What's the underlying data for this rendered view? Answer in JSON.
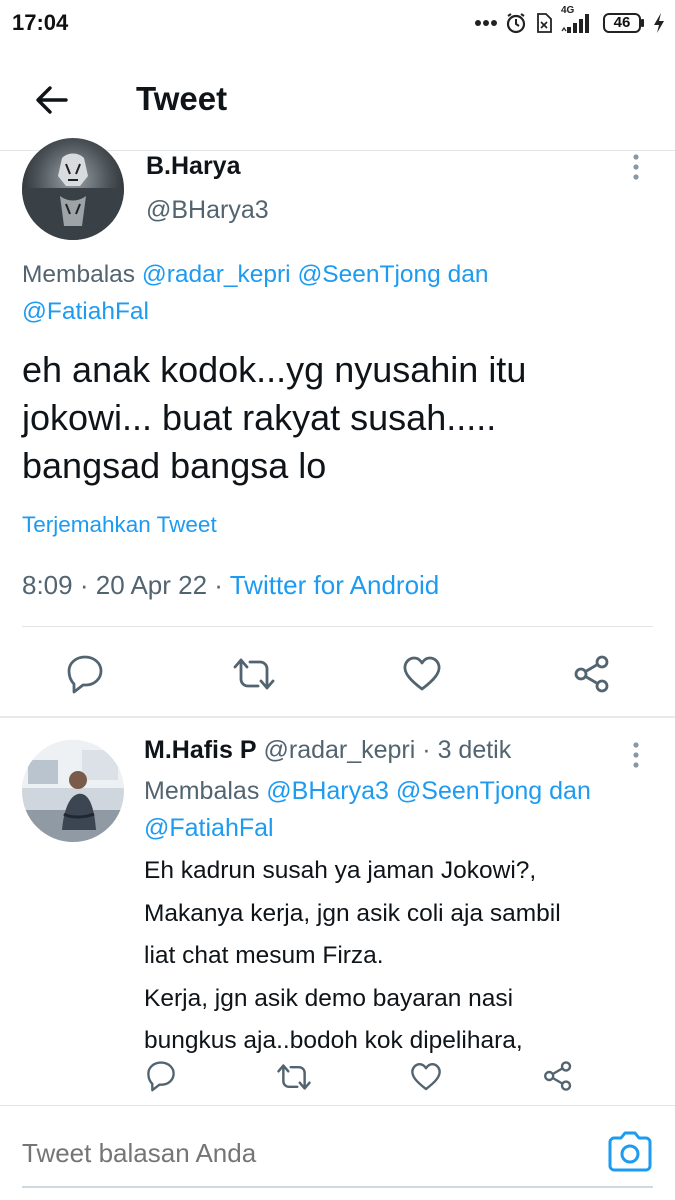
{
  "status_bar": {
    "time": "17:04",
    "network": "4G",
    "battery": "46",
    "icons": [
      "more-dots-icon",
      "alarm-icon",
      "no-sim-icon",
      "signal-icon",
      "battery-icon",
      "charging-icon"
    ]
  },
  "header": {
    "title": "Tweet",
    "back_icon": "arrow-left-icon"
  },
  "main_tweet": {
    "author_name": "B.Harya",
    "author_handle": "@BHarya3",
    "reply_prefix": "Membalas",
    "mentions": [
      "@radar_kepri",
      "@SeenTjong"
    ],
    "mention_joiner": "dan",
    "last_mention": "@FatiahFal",
    "text_lines": [
      "eh anak kodok...yg nyusahin itu",
      "jokowi... buat rakyat susah.....",
      "bangsad bangsa lo"
    ],
    "translate_label": "Terjemahkan Tweet",
    "time": "8:09",
    "date": "20 Apr 22",
    "source": "Twitter for Android",
    "actions": [
      "reply-icon",
      "retweet-icon",
      "like-icon",
      "share-icon"
    ]
  },
  "reply_tweet": {
    "author_name": "M.Hafis P",
    "author_handle": "@radar_kepri",
    "age": "3 detik",
    "reply_prefix": "Membalas",
    "mentions": [
      "@BHarya3",
      "@SeenTjong"
    ],
    "mention_joiner": "dan",
    "last_mention": "@FatiahFal",
    "text_lines": [
      "Eh kadrun susah ya jaman Jokowi?,",
      "Makanya kerja, jgn asik coli aja sambil",
      "liat chat mesum Firza.",
      "Kerja, jgn asik demo bayaran nasi",
      "bungkus aja..bodoh kok dipelihara,"
    ]
  },
  "compose": {
    "placeholder": "Tweet balasan Anda",
    "camera_icon": "camera-icon"
  },
  "colors": {
    "accent": "#1d9bf0",
    "text": "#0f1419",
    "secondary": "#536471",
    "divider": "#e1e5e8"
  }
}
